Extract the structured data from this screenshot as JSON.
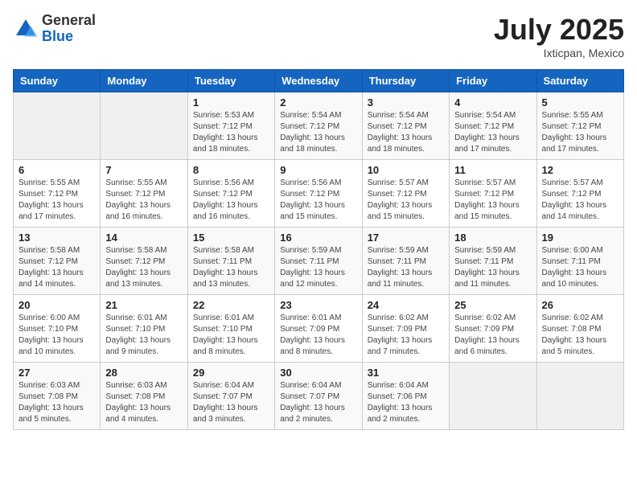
{
  "header": {
    "logo_general": "General",
    "logo_blue": "Blue",
    "title": "July 2025",
    "location": "Ixticpan, Mexico"
  },
  "weekdays": [
    "Sunday",
    "Monday",
    "Tuesday",
    "Wednesday",
    "Thursday",
    "Friday",
    "Saturday"
  ],
  "weeks": [
    [
      {
        "day": "",
        "info": ""
      },
      {
        "day": "",
        "info": ""
      },
      {
        "day": "1",
        "info": "Sunrise: 5:53 AM\nSunset: 7:12 PM\nDaylight: 13 hours\nand 18 minutes."
      },
      {
        "day": "2",
        "info": "Sunrise: 5:54 AM\nSunset: 7:12 PM\nDaylight: 13 hours\nand 18 minutes."
      },
      {
        "day": "3",
        "info": "Sunrise: 5:54 AM\nSunset: 7:12 PM\nDaylight: 13 hours\nand 18 minutes."
      },
      {
        "day": "4",
        "info": "Sunrise: 5:54 AM\nSunset: 7:12 PM\nDaylight: 13 hours\nand 17 minutes."
      },
      {
        "day": "5",
        "info": "Sunrise: 5:55 AM\nSunset: 7:12 PM\nDaylight: 13 hours\nand 17 minutes."
      }
    ],
    [
      {
        "day": "6",
        "info": "Sunrise: 5:55 AM\nSunset: 7:12 PM\nDaylight: 13 hours\nand 17 minutes."
      },
      {
        "day": "7",
        "info": "Sunrise: 5:55 AM\nSunset: 7:12 PM\nDaylight: 13 hours\nand 16 minutes."
      },
      {
        "day": "8",
        "info": "Sunrise: 5:56 AM\nSunset: 7:12 PM\nDaylight: 13 hours\nand 16 minutes."
      },
      {
        "day": "9",
        "info": "Sunrise: 5:56 AM\nSunset: 7:12 PM\nDaylight: 13 hours\nand 15 minutes."
      },
      {
        "day": "10",
        "info": "Sunrise: 5:57 AM\nSunset: 7:12 PM\nDaylight: 13 hours\nand 15 minutes."
      },
      {
        "day": "11",
        "info": "Sunrise: 5:57 AM\nSunset: 7:12 PM\nDaylight: 13 hours\nand 15 minutes."
      },
      {
        "day": "12",
        "info": "Sunrise: 5:57 AM\nSunset: 7:12 PM\nDaylight: 13 hours\nand 14 minutes."
      }
    ],
    [
      {
        "day": "13",
        "info": "Sunrise: 5:58 AM\nSunset: 7:12 PM\nDaylight: 13 hours\nand 14 minutes."
      },
      {
        "day": "14",
        "info": "Sunrise: 5:58 AM\nSunset: 7:12 PM\nDaylight: 13 hours\nand 13 minutes."
      },
      {
        "day": "15",
        "info": "Sunrise: 5:58 AM\nSunset: 7:11 PM\nDaylight: 13 hours\nand 13 minutes."
      },
      {
        "day": "16",
        "info": "Sunrise: 5:59 AM\nSunset: 7:11 PM\nDaylight: 13 hours\nand 12 minutes."
      },
      {
        "day": "17",
        "info": "Sunrise: 5:59 AM\nSunset: 7:11 PM\nDaylight: 13 hours\nand 11 minutes."
      },
      {
        "day": "18",
        "info": "Sunrise: 5:59 AM\nSunset: 7:11 PM\nDaylight: 13 hours\nand 11 minutes."
      },
      {
        "day": "19",
        "info": "Sunrise: 6:00 AM\nSunset: 7:11 PM\nDaylight: 13 hours\nand 10 minutes."
      }
    ],
    [
      {
        "day": "20",
        "info": "Sunrise: 6:00 AM\nSunset: 7:10 PM\nDaylight: 13 hours\nand 10 minutes."
      },
      {
        "day": "21",
        "info": "Sunrise: 6:01 AM\nSunset: 7:10 PM\nDaylight: 13 hours\nand 9 minutes."
      },
      {
        "day": "22",
        "info": "Sunrise: 6:01 AM\nSunset: 7:10 PM\nDaylight: 13 hours\nand 8 minutes."
      },
      {
        "day": "23",
        "info": "Sunrise: 6:01 AM\nSunset: 7:09 PM\nDaylight: 13 hours\nand 8 minutes."
      },
      {
        "day": "24",
        "info": "Sunrise: 6:02 AM\nSunset: 7:09 PM\nDaylight: 13 hours\nand 7 minutes."
      },
      {
        "day": "25",
        "info": "Sunrise: 6:02 AM\nSunset: 7:09 PM\nDaylight: 13 hours\nand 6 minutes."
      },
      {
        "day": "26",
        "info": "Sunrise: 6:02 AM\nSunset: 7:08 PM\nDaylight: 13 hours\nand 5 minutes."
      }
    ],
    [
      {
        "day": "27",
        "info": "Sunrise: 6:03 AM\nSunset: 7:08 PM\nDaylight: 13 hours\nand 5 minutes."
      },
      {
        "day": "28",
        "info": "Sunrise: 6:03 AM\nSunset: 7:08 PM\nDaylight: 13 hours\nand 4 minutes."
      },
      {
        "day": "29",
        "info": "Sunrise: 6:04 AM\nSunset: 7:07 PM\nDaylight: 13 hours\nand 3 minutes."
      },
      {
        "day": "30",
        "info": "Sunrise: 6:04 AM\nSunset: 7:07 PM\nDaylight: 13 hours\nand 2 minutes."
      },
      {
        "day": "31",
        "info": "Sunrise: 6:04 AM\nSunset: 7:06 PM\nDaylight: 13 hours\nand 2 minutes."
      },
      {
        "day": "",
        "info": ""
      },
      {
        "day": "",
        "info": ""
      }
    ]
  ]
}
